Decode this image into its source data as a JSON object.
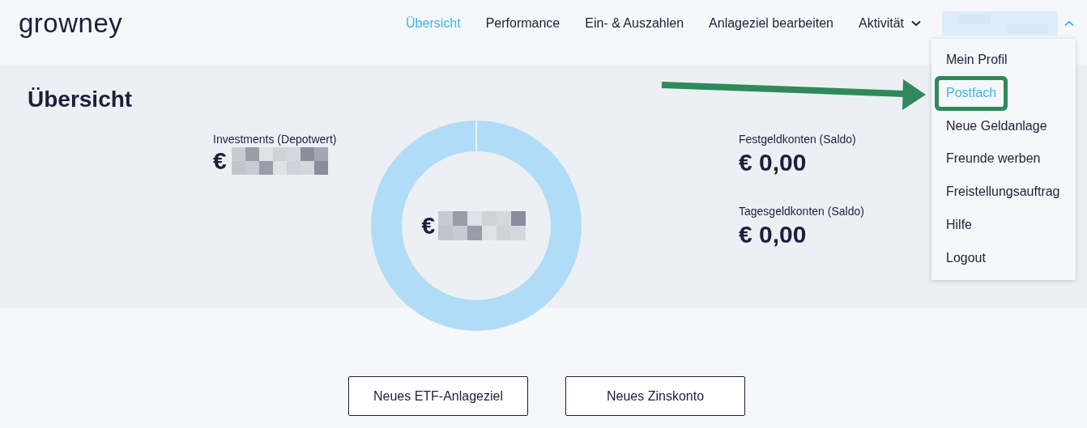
{
  "logo": "growney",
  "nav": [
    {
      "label": "Übersicht",
      "selected": true
    },
    {
      "label": "Performance",
      "selected": false
    },
    {
      "label": "Ein- & Auszahlen",
      "selected": false
    },
    {
      "label": "Anlageziel bearbeiten",
      "selected": false
    },
    {
      "label": "Aktivität",
      "selected": false,
      "kind": "dropdown"
    }
  ],
  "account_menu": {
    "expanded": true,
    "items": [
      {
        "label": "Mein Profil",
        "selected": false,
        "highlighted": false
      },
      {
        "label": "Postfach",
        "selected": true,
        "highlighted": true
      },
      {
        "label": "Neue Geldanlage",
        "selected": false,
        "highlighted": false
      },
      {
        "label": "Freunde werben",
        "selected": false,
        "highlighted": false
      },
      {
        "label": "Freistellungsauftrag",
        "selected": false,
        "highlighted": false
      },
      {
        "label": "Hilfe",
        "selected": false,
        "highlighted": false
      },
      {
        "label": "Logout",
        "selected": false,
        "highlighted": false
      }
    ]
  },
  "overview": {
    "title": "Übersicht",
    "investments": {
      "label": "Investments (Depotwert)",
      "currency": "€"
    },
    "total": {
      "currency": "€"
    },
    "accounts": [
      {
        "label": "Festgeldkonten (Saldo)",
        "value": "€ 0,00"
      },
      {
        "label": "Tagesgeldkonten (Saldo)",
        "value": "€ 0,00"
      }
    ]
  },
  "buttons": [
    "Neues ETF-Anlageziel",
    "Neues Zinskonto"
  ]
}
